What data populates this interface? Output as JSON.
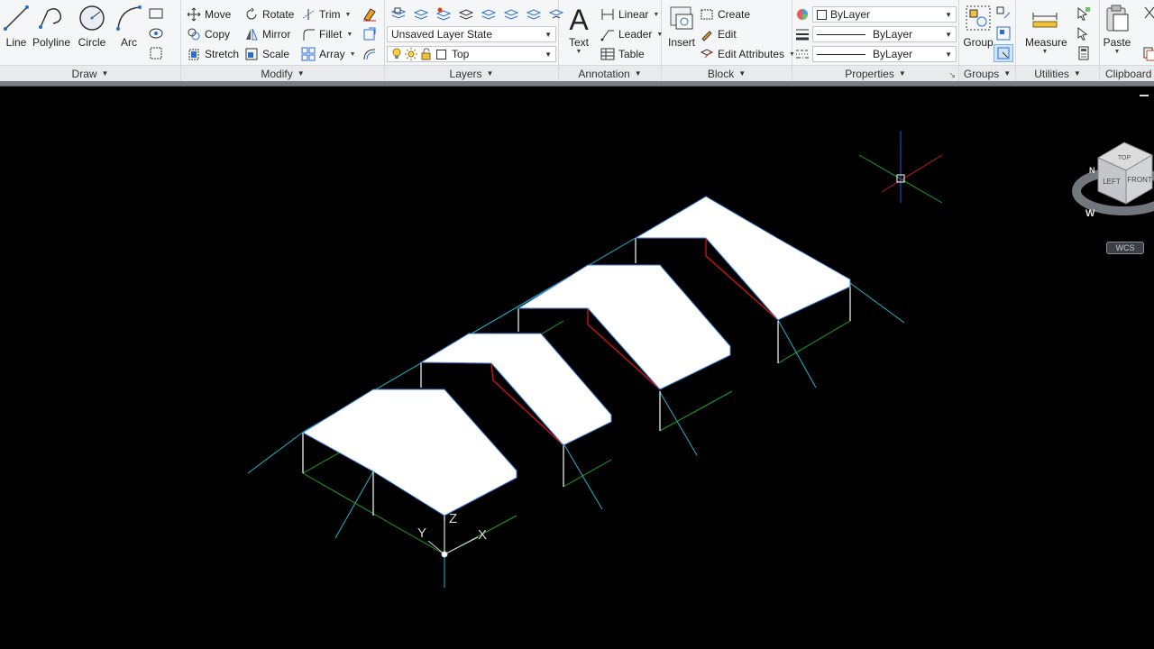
{
  "ribbon": {
    "draw": {
      "title": "Draw",
      "line": "Line",
      "polyline": "Polyline",
      "circle": "Circle",
      "arc": "Arc"
    },
    "modify": {
      "title": "Modify",
      "move": "Move",
      "rotate": "Rotate",
      "trim": "Trim",
      "copy": "Copy",
      "mirror": "Mirror",
      "fillet": "Fillet",
      "stretch": "Stretch",
      "scale": "Scale",
      "array": "Array"
    },
    "layers": {
      "title": "Layers",
      "layer_state": "Unsaved Layer State",
      "current_layer": "Top"
    },
    "annotation": {
      "title": "Annotation",
      "text": "Text",
      "linear": "Linear",
      "leader": "Leader",
      "table": "Table"
    },
    "block": {
      "title": "Block",
      "insert": "Insert",
      "create": "Create",
      "edit": "Edit",
      "edit_attributes": "Edit Attributes"
    },
    "properties": {
      "title": "Properties",
      "color": "ByLayer",
      "lineweight": "ByLayer",
      "linetype": "ByLayer"
    },
    "groups": {
      "title": "Groups",
      "group": "Group"
    },
    "utilities": {
      "title": "Utilities",
      "measure": "Measure"
    },
    "clipboard": {
      "title": "Clipboard",
      "paste": "Paste"
    }
  },
  "viewport": {
    "viewcube": {
      "top": "TOP",
      "left": "LEFT",
      "front": "FRONT",
      "compass_w": "W",
      "compass_n": "N"
    },
    "wcs_label": "WCS",
    "ucs": {
      "x": "X",
      "y": "Y",
      "z": "Z"
    }
  },
  "colors": {
    "ribbon_bg": "#f5f6f7",
    "viewport_bg": "#000000",
    "roof": "#ffffff",
    "frame_red": "#e01010",
    "axis_green": "#1fa01f",
    "axis_cyan": "#1fb6cf",
    "edge_blue": "#3b7fd8"
  }
}
